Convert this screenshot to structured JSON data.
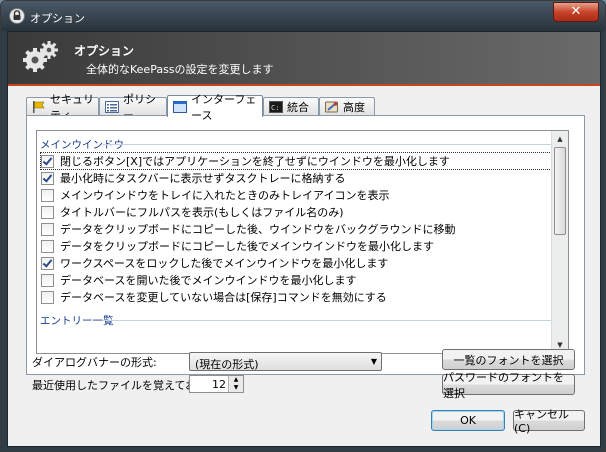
{
  "window": {
    "title": "オプション"
  },
  "banner": {
    "title": "オプション",
    "subtitle": "全体的なKeePassの設定を変更します"
  },
  "tabs": [
    {
      "label": "セキュリティ",
      "icon": "security-flag-icon"
    },
    {
      "label": "ポリシー",
      "icon": "policy-list-icon"
    },
    {
      "label": "インターフェース",
      "icon": "interface-window-icon",
      "active": true
    },
    {
      "label": "統合",
      "icon": "integration-console-icon"
    },
    {
      "label": "高度",
      "icon": "advanced-tools-icon"
    }
  ],
  "groups": {
    "main_window": "メインウインドウ",
    "entry_list": "エントリー一覧"
  },
  "options": [
    {
      "label": "閉じるボタン[X]ではアプリケーションを終了せずにウインドウを最小化します",
      "checked": true
    },
    {
      "label": "最小化時にタスクバーに表示せずタスクトレーに格納する",
      "checked": true
    },
    {
      "label": "メインウインドウをトレイに入れたときのみトレイアイコンを表示",
      "checked": false
    },
    {
      "label": "タイトルバーにフルパスを表示(もしくはファイル名のみ)",
      "checked": false
    },
    {
      "label": "データをクリップボードにコピーした後、ウインドウをバックグラウンドに移動",
      "checked": false
    },
    {
      "label": "データをクリップボードにコピーした後でメインウインドウを最小化します",
      "checked": false
    },
    {
      "label": "ワークスペースをロックした後でメインウインドウを最小化します",
      "checked": true
    },
    {
      "label": "データベースを開いた後でメインウインドウを最小化します",
      "checked": false
    },
    {
      "label": "データベースを変更していない場合は[保存]コマンドを無効にする",
      "checked": false
    }
  ],
  "bottom": {
    "banner_style_label": "ダイアログバナーの形式:",
    "banner_style_value": "(現在の形式)",
    "mru_label": "最近使用したファイルを覚えておく:",
    "mru_value": "12",
    "list_font_button": "一覧のフォントを選択",
    "password_font_button": "パスワードのフォントを選択"
  },
  "buttons": {
    "ok": "OK",
    "cancel": "キャンセル(C)"
  },
  "colors": {
    "accent": "#c8441c",
    "group_header": "#1a3c8c"
  }
}
